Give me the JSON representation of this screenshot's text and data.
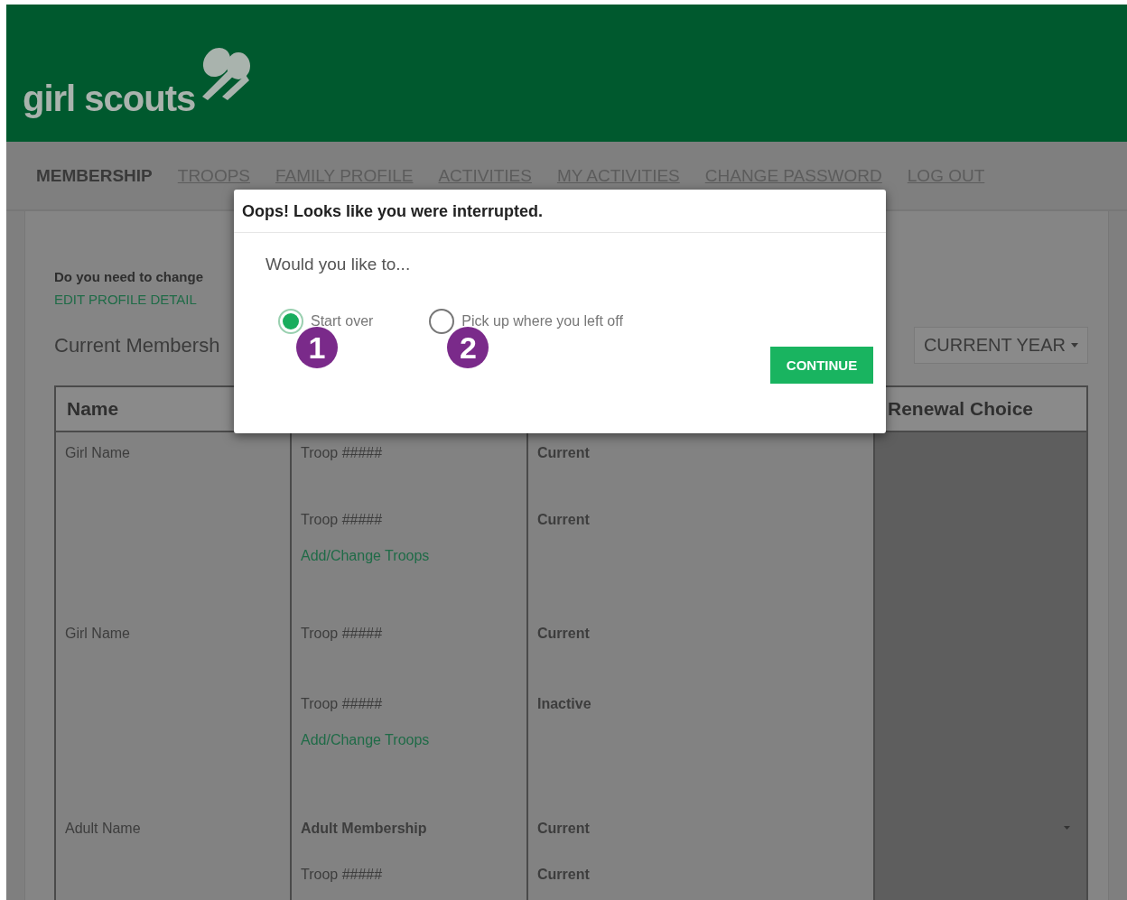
{
  "logo": {
    "text": "girl scouts"
  },
  "nav": [
    {
      "label": "MEMBERSHIP",
      "selected": true
    },
    {
      "label": "TROOPS",
      "selected": false
    },
    {
      "label": "FAMILY PROFILE",
      "selected": false
    },
    {
      "label": "ACTIVITIES",
      "selected": false
    },
    {
      "label": "MY ACTIVITIES",
      "selected": false
    },
    {
      "label": "CHANGE PASSWORD",
      "selected": false
    },
    {
      "label": "LOG OUT",
      "selected": false
    }
  ],
  "profile_prompt": "Do you need to change",
  "profile_link": "EDIT PROFILE DETAIL",
  "section_title": "Current Membersh",
  "year_dropdown": "CURRENT YEAR",
  "table": {
    "name_column": "Name",
    "renewal_column": "Renewal Choice",
    "members": [
      {
        "name": "Girl Name",
        "entries": [
          {
            "kind": "troop",
            "label": "Troop #####",
            "status": "Current"
          },
          {
            "kind": "troop",
            "label": "Troop #####",
            "status": "Current"
          }
        ],
        "link": "Add/Change Troops",
        "renewal_dropdown": false
      },
      {
        "name": "Girl Name",
        "entries": [
          {
            "kind": "troop",
            "label": "Troop #####",
            "status": "Current"
          },
          {
            "kind": "troop",
            "label": "Troop #####",
            "status": "Inactive"
          }
        ],
        "link": "Add/Change Troops",
        "renewal_dropdown": false
      },
      {
        "name": "Adult Name",
        "entries": [
          {
            "kind": "membership",
            "label": "Adult Membership",
            "status": "Current"
          },
          {
            "kind": "troop",
            "label": "Troop #####",
            "status": "Current"
          }
        ],
        "renewal_dropdown": true
      }
    ]
  },
  "dialog": {
    "title": "Oops! Looks like you were interrupted.",
    "question": "Would you like to...",
    "options": [
      {
        "label": "Start over",
        "selected": true,
        "badge": "1"
      },
      {
        "label": "Pick up where you left off",
        "selected": false,
        "badge": "2"
      }
    ],
    "button": "CONTINUE"
  }
}
